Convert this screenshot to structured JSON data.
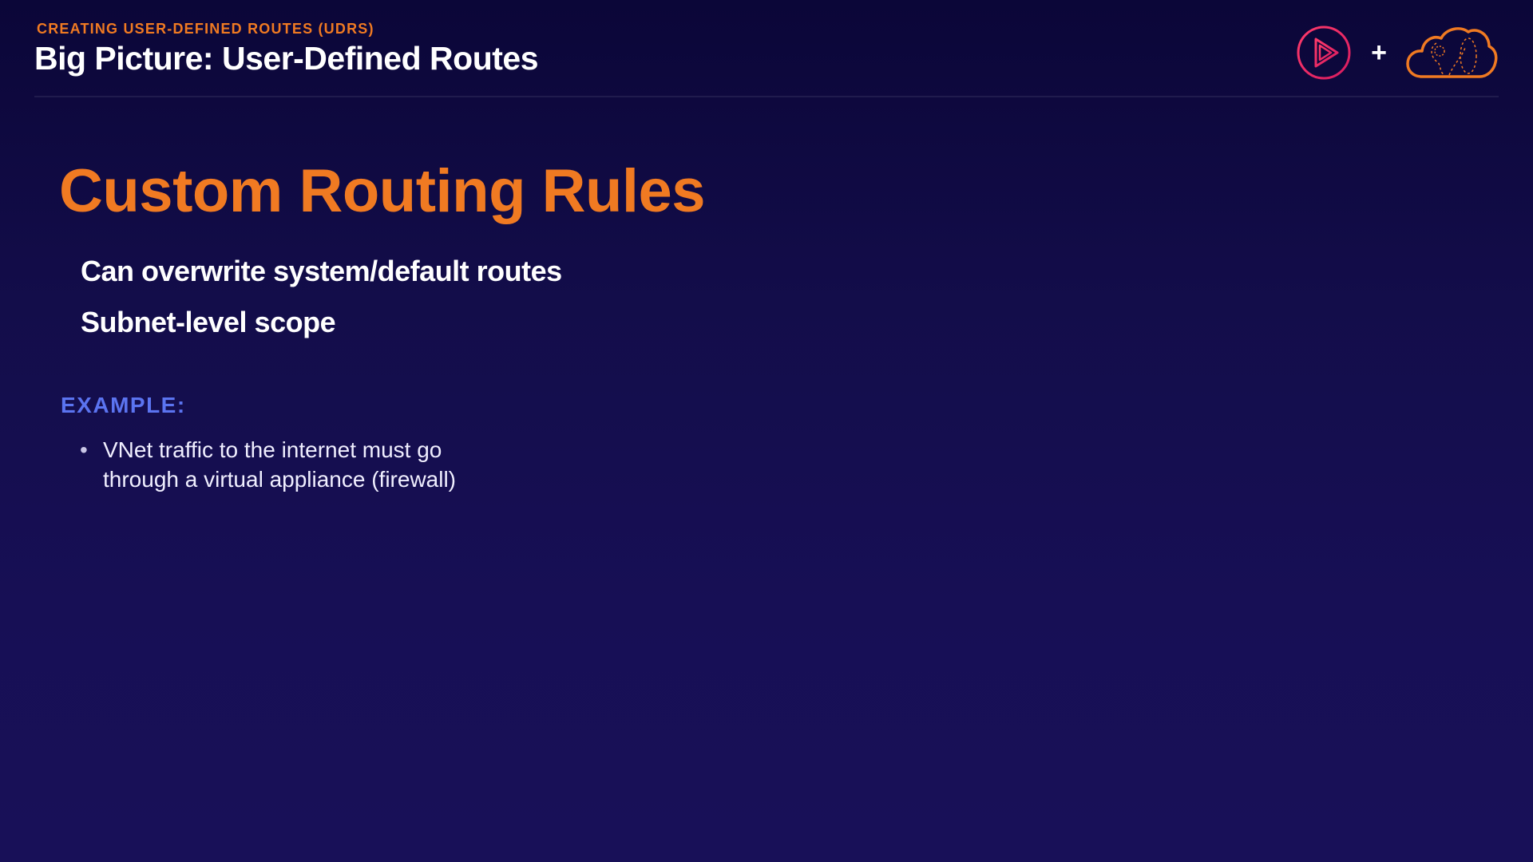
{
  "header": {
    "eyebrow": "CREATING USER-DEFINED ROUTES (UDRS)",
    "title": "Big Picture: User-Defined Routes",
    "plus": "+"
  },
  "content": {
    "title": "Custom Routing Rules",
    "points": [
      "Can overwrite system/default routes",
      "Subnet-level scope"
    ],
    "example_label": "EXAMPLE:",
    "example_bullet": "•",
    "example_lines": [
      "VNet traffic to the internet must go",
      "through a virtual appliance (firewall)"
    ]
  },
  "icons": {
    "left_logo": "play-logo-icon",
    "right_logo": "cloud-logo-icon"
  },
  "colors": {
    "accent_orange": "#f07a22",
    "accent_pink": "#e8265a",
    "label_blue": "#5b74f0",
    "background_top": "#0b0638",
    "background_bottom": "#181058"
  }
}
